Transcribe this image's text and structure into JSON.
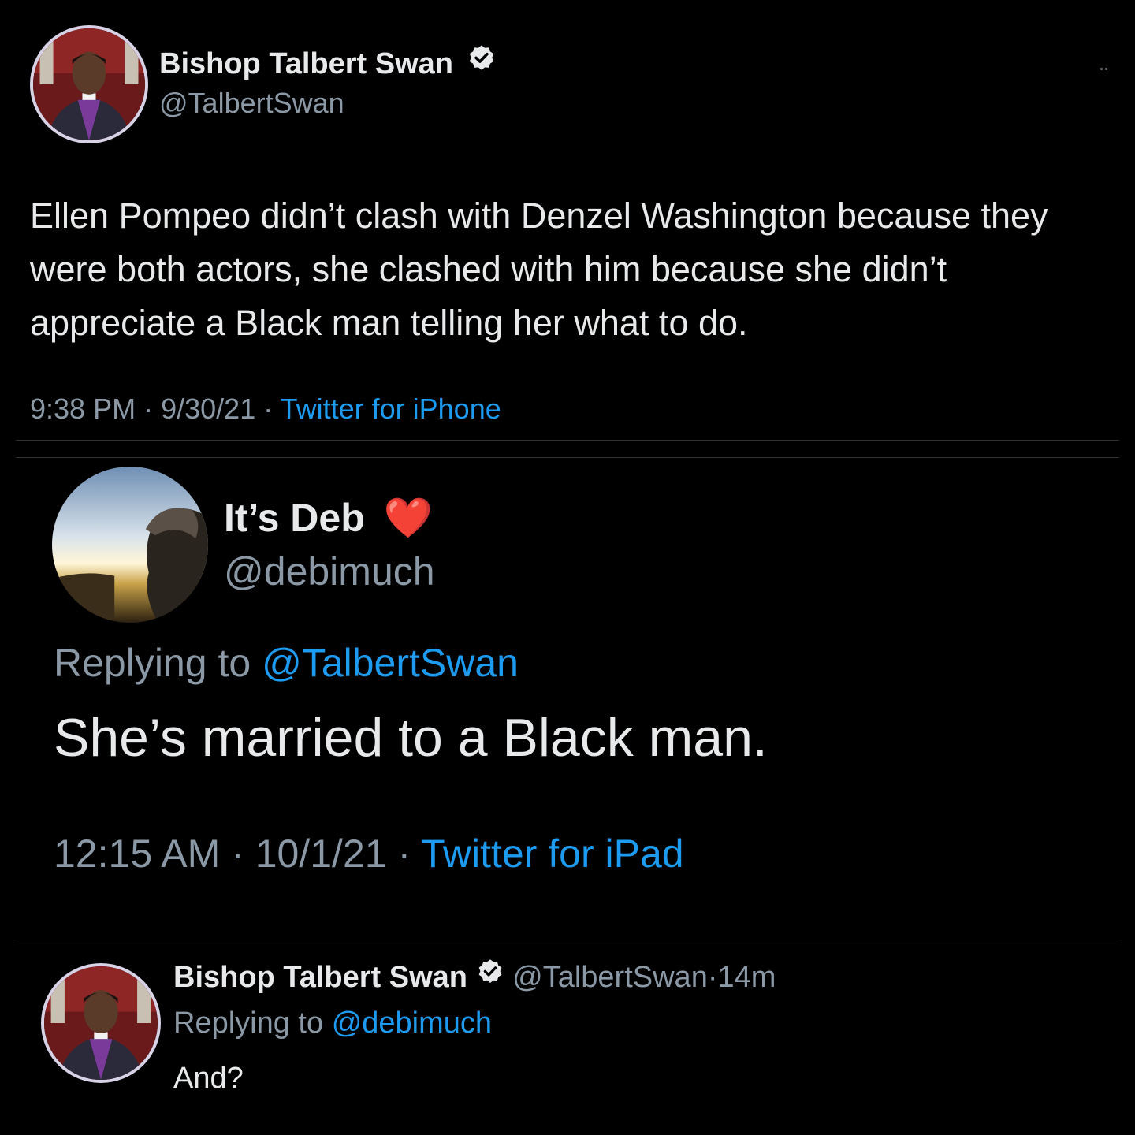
{
  "tweet1": {
    "author_name": "Bishop Talbert Swan",
    "author_handle": "@TalbertSwan",
    "verified_icon": "verified-badge-icon",
    "body": "Ellen Pompeo didn’t clash with Denzel Washington because they were both actors, she clashed with him because she didn’t appreciate a Black man telling her what to do.",
    "time": "9:38 PM",
    "date": "9/30/21",
    "separator": "·",
    "source": "Twitter for iPhone"
  },
  "tweet2": {
    "author_name": "It’s Deb",
    "name_emoji": "❤️",
    "author_handle": "@debimuch",
    "replying_label": "Replying to",
    "replying_handle": "@TalbertSwan",
    "body": "She’s married to a Black man.",
    "time": "12:15 AM",
    "date": "10/1/21",
    "separator": "·",
    "source": "Twitter for iPad"
  },
  "tweet3": {
    "author_name": "Bishop Talbert Swan",
    "verified_icon": "verified-badge-icon",
    "author_handle": "@TalbertSwan",
    "separator": "·",
    "age": "14m",
    "replying_label": "Replying to",
    "replying_handle": "@debimuch",
    "body": "And?"
  },
  "colors": {
    "background": "#000000",
    "text": "#e7e9ea",
    "muted": "#8b98a5",
    "link": "#1d9bf0",
    "divider": "#2f3336"
  }
}
